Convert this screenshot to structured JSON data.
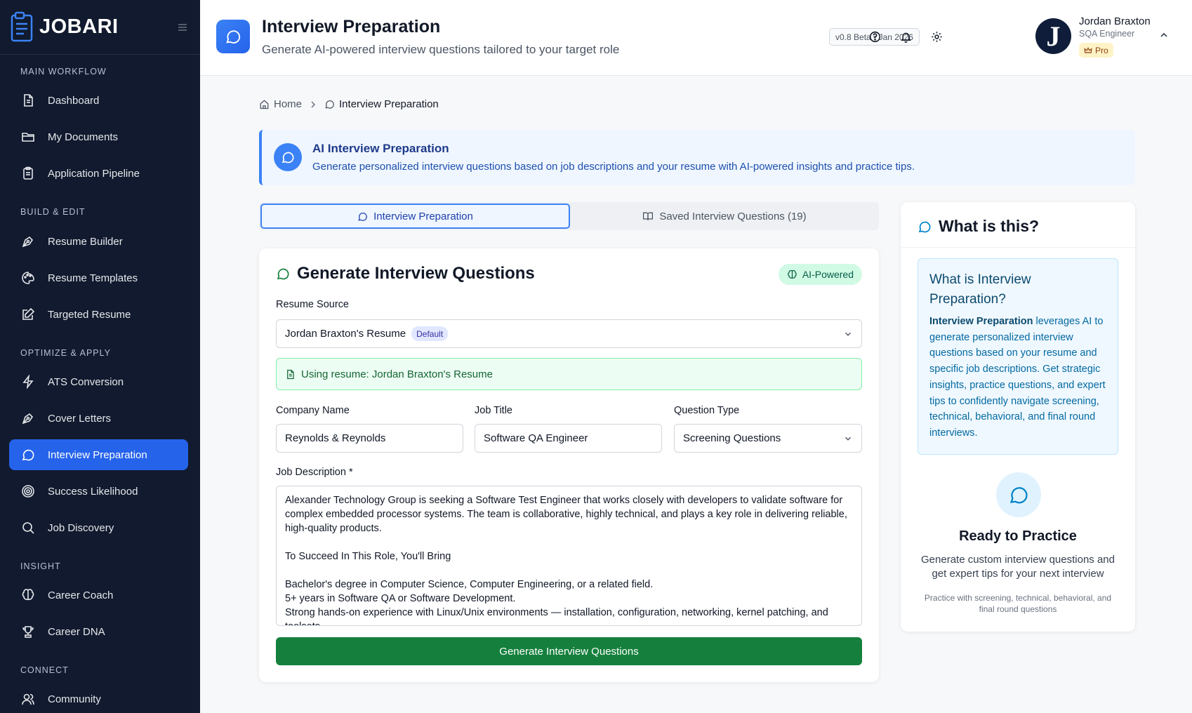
{
  "app": {
    "name": "JOBARI"
  },
  "sidebar": {
    "sections": [
      {
        "title": "MAIN WORKFLOW",
        "items": [
          {
            "label": "Dashboard",
            "icon": "document-icon"
          },
          {
            "label": "My Documents",
            "icon": "folder-icon"
          },
          {
            "label": "Application Pipeline",
            "icon": "clipboard-icon"
          }
        ]
      },
      {
        "title": "BUILD & EDIT",
        "items": [
          {
            "label": "Resume Builder",
            "icon": "pen-tool-icon"
          },
          {
            "label": "Resume Templates",
            "icon": "palette-icon"
          },
          {
            "label": "Targeted Resume",
            "icon": "edit-icon"
          }
        ]
      },
      {
        "title": "OPTIMIZE & APPLY",
        "items": [
          {
            "label": "ATS Conversion",
            "icon": "lightning-icon"
          },
          {
            "label": "Cover Letters",
            "icon": "pen-tool-icon"
          },
          {
            "label": "Interview Preparation",
            "icon": "chat-icon",
            "active": true
          },
          {
            "label": "Success Likelihood",
            "icon": "target-icon"
          },
          {
            "label": "Job Discovery",
            "icon": "search-icon"
          }
        ]
      },
      {
        "title": "INSIGHT",
        "items": [
          {
            "label": "Career Coach",
            "icon": "brain-icon"
          },
          {
            "label": "Career DNA",
            "icon": "trophy-icon"
          }
        ]
      },
      {
        "title": "CONNECT",
        "items": [
          {
            "label": "Community",
            "icon": "users-icon"
          }
        ]
      }
    ]
  },
  "header": {
    "title": "Interview Preparation",
    "subtitle": "Generate AI-powered interview questions tailored to your target role",
    "version": "v0.8 Beta • Jan 2026"
  },
  "user": {
    "name": "Jordan Braxton",
    "role": "SQA Engineer",
    "plan": "Pro",
    "initial": "J"
  },
  "breadcrumb": {
    "home": "Home",
    "current": "Interview Preparation"
  },
  "banner": {
    "title": "AI Interview Preparation",
    "description": "Generate personalized interview questions based on job descriptions and your resume with AI-powered insights and practice tips."
  },
  "tabs": [
    {
      "label": "Interview Preparation",
      "active": true
    },
    {
      "label": "Saved Interview Questions (19)",
      "active": false
    }
  ],
  "form": {
    "title": "Generate Interview Questions",
    "ai_badge": "AI-Powered",
    "resume_source_label": "Resume Source",
    "resume_value": "Jordan Braxton's Resume",
    "resume_default_pill": "Default",
    "using_resume_text": "Using resume: Jordan Braxton's Resume",
    "company_label": "Company Name",
    "company_value": "Reynolds & Reynolds",
    "job_title_label": "Job Title",
    "job_title_value": "Software QA Engineer",
    "question_type_label": "Question Type",
    "question_type_value": "Screening Questions",
    "job_description_label": "Job Description *",
    "job_description_value": "Alexander Technology Group is seeking a Software Test Engineer that works closely with developers to validate software for complex embedded processor systems. The team is collaborative, highly technical, and plays a key role in delivering reliable, high-quality products.\n\nTo Succeed In This Role, You'll Bring\n\nBachelor's degree in Computer Science, Computer Engineering, or a related field.\n5+ years in Software QA or Software Development.\nStrong hands-on experience with Linux/Unix environments — installation, configuration, networking, kernel patching, and toolsets.",
    "generate_button": "Generate Interview Questions"
  },
  "side_panel": {
    "title": "What is this?",
    "box_title": "What is Interview Preparation?",
    "box_bold": "Interview Preparation",
    "box_text": " leverages AI to generate personalized interview questions based on your resume and specific job descriptions. Get strategic insights, practice questions, and expert tips to confidently navigate screening, technical, behavioral, and final round interviews.",
    "ready_title": "Ready to Practice",
    "ready_desc": "Generate custom interview questions and get expert tips for your next interview",
    "ready_note": "Practice with screening, technical, behavioral, and final round questions"
  },
  "colors": {
    "accent": "#2563eb",
    "sidebar_bg": "#111a2e",
    "success": "#15803d"
  }
}
